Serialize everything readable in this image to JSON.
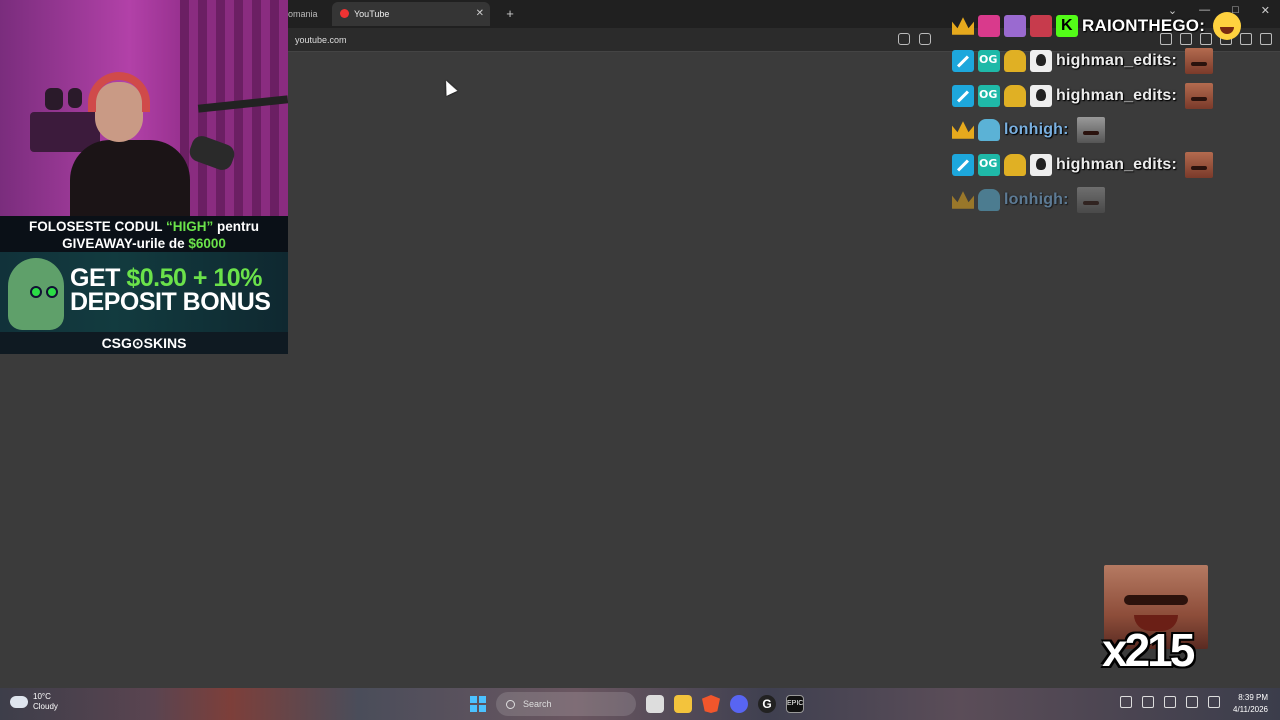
{
  "browser": {
    "partial_tab_label": "omania",
    "active_tab_title": "YouTube",
    "close_glyph": "✕",
    "new_tab_glyph": "+",
    "url": "youtube.com",
    "window_controls": [
      "⌄",
      "—",
      "□",
      "✕"
    ]
  },
  "overlay": {
    "ad": {
      "top_line1_a": "FOLOSESTE CODUL ",
      "top_line1_code": "“HIGH”",
      "top_line1_b": " pentru",
      "top_line2_a": "GIVEAWAY-urile de ",
      "top_line2_amount": "$6000",
      "headline_a": "GET ",
      "headline_amount": "$0.50 + 10%",
      "headline_b": "DEPOSIT BONUS",
      "brand": "CSG⊙SKINS"
    },
    "chat": [
      {
        "name": "RAIONTHEGO:"
      },
      {
        "name": "highman_edits:"
      },
      {
        "name": "highman_edits:"
      },
      {
        "name": "lonhigh:"
      },
      {
        "name": "highman_edits:"
      },
      {
        "name": "lonhigh:"
      }
    ],
    "combo_count": "x215"
  },
  "taskbar": {
    "weather_temp": "10°C",
    "weather_desc": "Cloudy",
    "search_placeholder": "Search",
    "epic_label": "EPIC",
    "g_label": "G",
    "time": "8:39 PM",
    "date": "4/11/2026"
  }
}
